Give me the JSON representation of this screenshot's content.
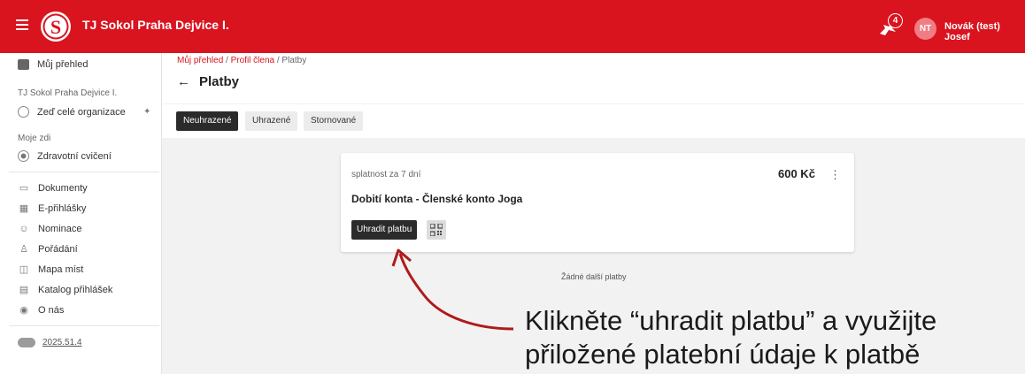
{
  "header": {
    "org_name": "TJ Sokol Praha Dejvice I.",
    "notification_count": "4",
    "user_initials": "NT",
    "user_name": "Novák (test) Josef",
    "brand_color": "#d9141f"
  },
  "sidebar": {
    "overview": "Můj přehled",
    "org_section": "TJ Sokol Praha Dejvice I.",
    "org_wall": "Zeď celé organizace",
    "my_walls_section": "Moje zdi",
    "health_exercise": "Zdravotní cvičení",
    "items": [
      {
        "label": "Dokumenty",
        "icon": "folder-icon"
      },
      {
        "label": "E-přihlášky",
        "icon": "calendar-icon"
      },
      {
        "label": "Nominace",
        "icon": "people-icon"
      },
      {
        "label": "Pořádání",
        "icon": "organize-icon"
      },
      {
        "label": "Mapa míst",
        "icon": "map-icon"
      },
      {
        "label": "Katalog přihlášek",
        "icon": "catalog-icon"
      },
      {
        "label": "O nás",
        "icon": "shield-icon"
      }
    ],
    "version": "2025.51.4"
  },
  "breadcrumb": {
    "item1": "Můj přehled",
    "item2": "Profil člena",
    "current": "Platby",
    "separator": "/"
  },
  "page": {
    "title": "Platby",
    "back_glyph": "←"
  },
  "tabs": {
    "unpaid": "Neuhrazené",
    "paid": "Uhrazené",
    "cancelled": "Stornované"
  },
  "payment": {
    "due": "splatnost za 7 dní",
    "amount": "600 Kč",
    "title": "Dobití konta - Členské konto Joga",
    "pay_button": "Uhradit platbu"
  },
  "no_more": "Žádné další platby",
  "annotation": {
    "line1": "Klikněte “uhradit platbu” a využijte",
    "line2": "přiložené platební údaje k platbě"
  }
}
